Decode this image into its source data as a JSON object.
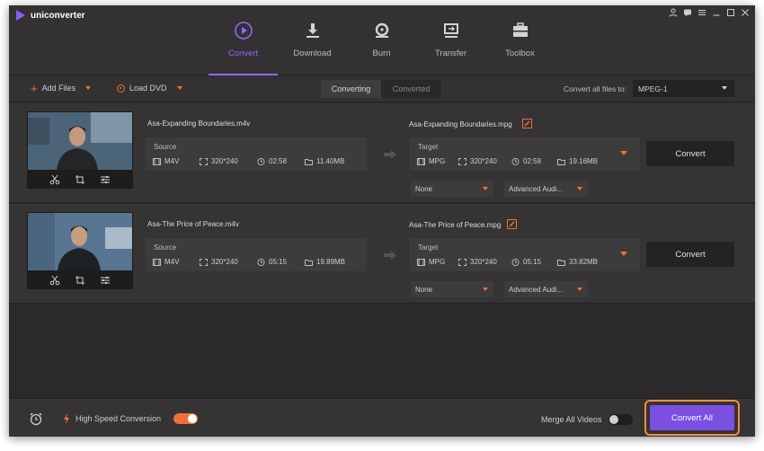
{
  "app": {
    "title": "uniconverter"
  },
  "window_controls": [
    "user-icon",
    "chat-icon",
    "menu-icon",
    "minimize-icon",
    "maximize-icon",
    "close-icon"
  ],
  "nav": {
    "tabs": [
      {
        "label": "Convert",
        "icon": "convert-icon",
        "active": true
      },
      {
        "label": "Download",
        "icon": "download-icon",
        "active": false
      },
      {
        "label": "Burn",
        "icon": "burn-icon",
        "active": false
      },
      {
        "label": "Transfer",
        "icon": "transfer-icon",
        "active": false
      },
      {
        "label": "Toolbox",
        "icon": "toolbox-icon",
        "active": false
      }
    ]
  },
  "toolbar": {
    "add_files": "Add Files",
    "load_dvd": "Load DVD",
    "segments": [
      "Converting",
      "Converted"
    ],
    "convert_to_label": "Convert all files to:",
    "format": "MPEG-1"
  },
  "files": [
    {
      "source_name": "Asa-Expanding Boundaries.m4v",
      "source_label": "Source",
      "source": {
        "format": "M4V",
        "resolution": "320*240",
        "duration": "02:58",
        "size": "11.40MB"
      },
      "target_name": "Asa-Expanding Boundaries.mpg",
      "target_label": "Target",
      "target": {
        "format": "MPG",
        "resolution": "320*240",
        "duration": "02:58",
        "size": "19.16MB"
      },
      "subtitle": "None",
      "audio": "Advanced Audi...",
      "convert_label": "Convert"
    },
    {
      "source_name": "Asa-The Price of Peace.m4v",
      "source_label": "Source",
      "source": {
        "format": "M4V",
        "resolution": "320*240",
        "duration": "05:15",
        "size": "19.89MB"
      },
      "target_name": "Asa-The Price of Peace.mpg",
      "target_label": "Target",
      "target": {
        "format": "MPG",
        "resolution": "320*240",
        "duration": "05:15",
        "size": "33.82MB"
      },
      "subtitle": "None",
      "audio": "Advanced Audi...",
      "convert_label": "Convert"
    }
  ],
  "bottom": {
    "high_speed_label": "High Speed Conversion",
    "high_speed_on": true,
    "merge_label": "Merge All Videos",
    "merge_on": false,
    "convert_all": "Convert All"
  },
  "colors": {
    "accent": "#8f6bff",
    "orange": "#f0703a",
    "button_purple": "#7b4fe0"
  }
}
